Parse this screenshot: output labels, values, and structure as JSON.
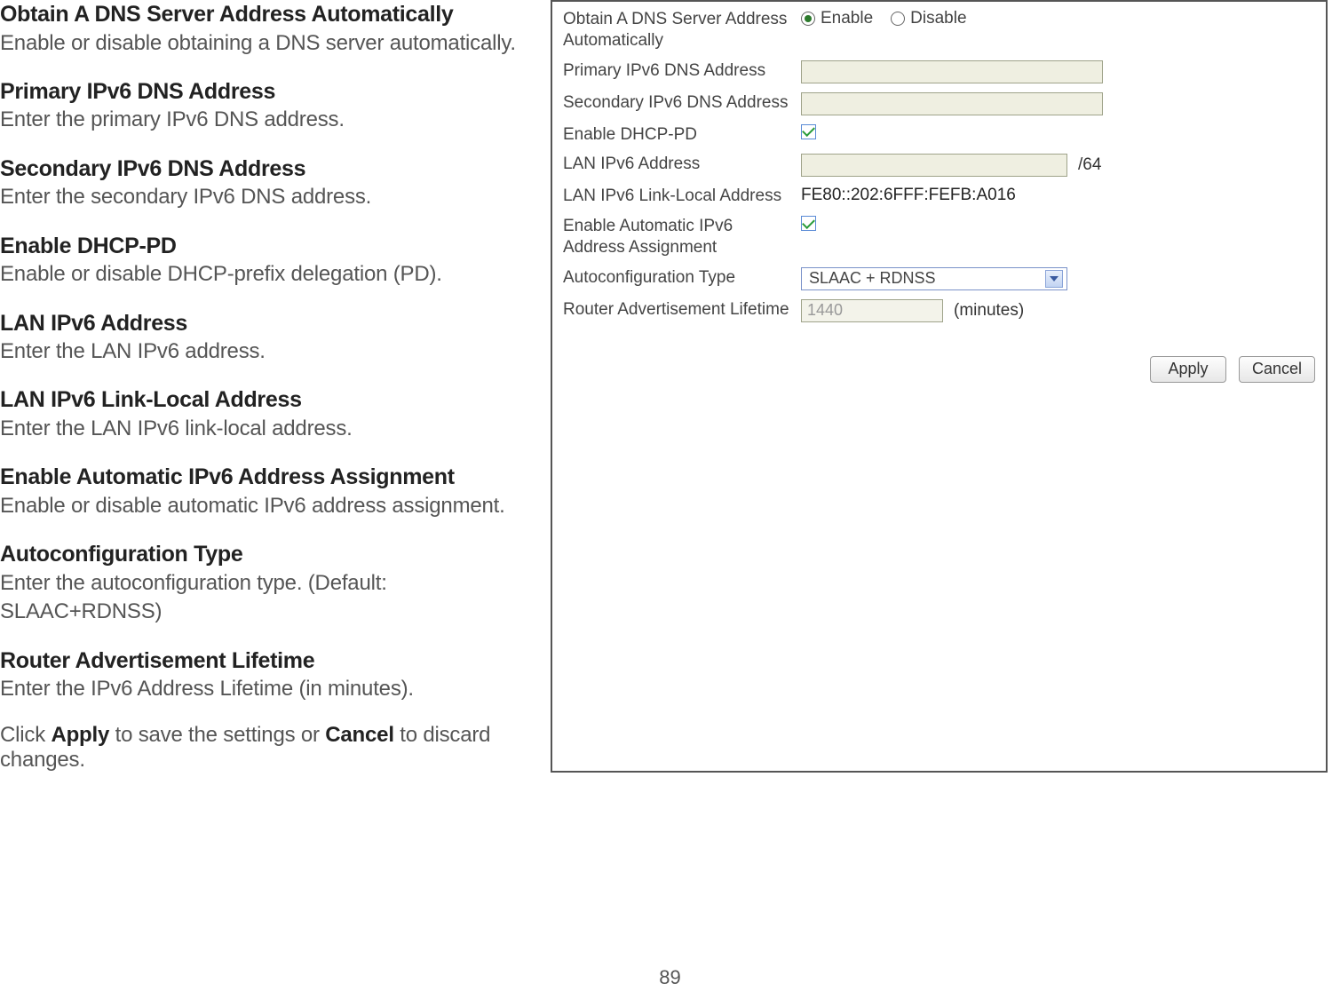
{
  "doc": {
    "items": [
      {
        "title": "Obtain A DNS Server Address Automatically",
        "desc": "Enable or disable obtaining a DNS server automatically."
      },
      {
        "title": "Primary IPv6 DNS Address",
        "desc": "Enter the primary IPv6 DNS address."
      },
      {
        "title": "Secondary IPv6 DNS Address",
        "desc": "Enter the secondary IPv6 DNS address."
      },
      {
        "title": "Enable DHCP-PD",
        "desc": "Enable or disable DHCP-prefix delegation (PD)."
      },
      {
        "title": "LAN IPv6 Address",
        "desc": "Enter the LAN IPv6 address."
      },
      {
        "title": "LAN IPv6 Link-Local Address",
        "desc": "Enter the LAN IPv6 link-local address."
      },
      {
        "title": "Enable Automatic IPv6 Address Assignment",
        "desc": "Enable or disable automatic IPv6 address assignment."
      },
      {
        "title": "Autoconfiguration Type",
        "desc": "Enter the autoconfiguration type. (Default: SLAAC+RDNSS)"
      },
      {
        "title": "Router Advertisement Lifetime",
        "desc": "Enter the IPv6 Address Lifetime (in minutes)."
      }
    ],
    "footer_pre": "Click ",
    "footer_apply": "Apply",
    "footer_mid": " to save the settings or ",
    "footer_cancel": "Cancel",
    "footer_post": " to discard changes."
  },
  "panel": {
    "rows": {
      "obtain_dns": {
        "label": "Obtain A DNS Server Address Automatically",
        "enable": "Enable",
        "disable": "Disable",
        "checked": "enable"
      },
      "primary_dns": {
        "label": "Primary IPv6 DNS Address",
        "value": ""
      },
      "secondary_dns": {
        "label": "Secondary IPv6 DNS Address",
        "value": ""
      },
      "dhcp_pd": {
        "label": "Enable DHCP-PD",
        "checked": true
      },
      "lan_ipv6": {
        "label": "LAN IPv6 Address",
        "value": "",
        "suffix": "/64"
      },
      "lan_linklocal": {
        "label": "LAN IPv6 Link-Local Address",
        "value": "FE80::202:6FFF:FEFB:A016"
      },
      "auto_assign": {
        "label": "Enable Automatic IPv6 Address Assignment",
        "checked": true
      },
      "autoconfig": {
        "label": "Autoconfiguration Type",
        "value": "SLAAC + RDNSS"
      },
      "ra_lifetime": {
        "label": "Router Advertisement Lifetime",
        "value": "1440",
        "suffix": "(minutes)"
      }
    },
    "buttons": {
      "apply": "Apply",
      "cancel": "Cancel"
    }
  },
  "page_number": "89"
}
